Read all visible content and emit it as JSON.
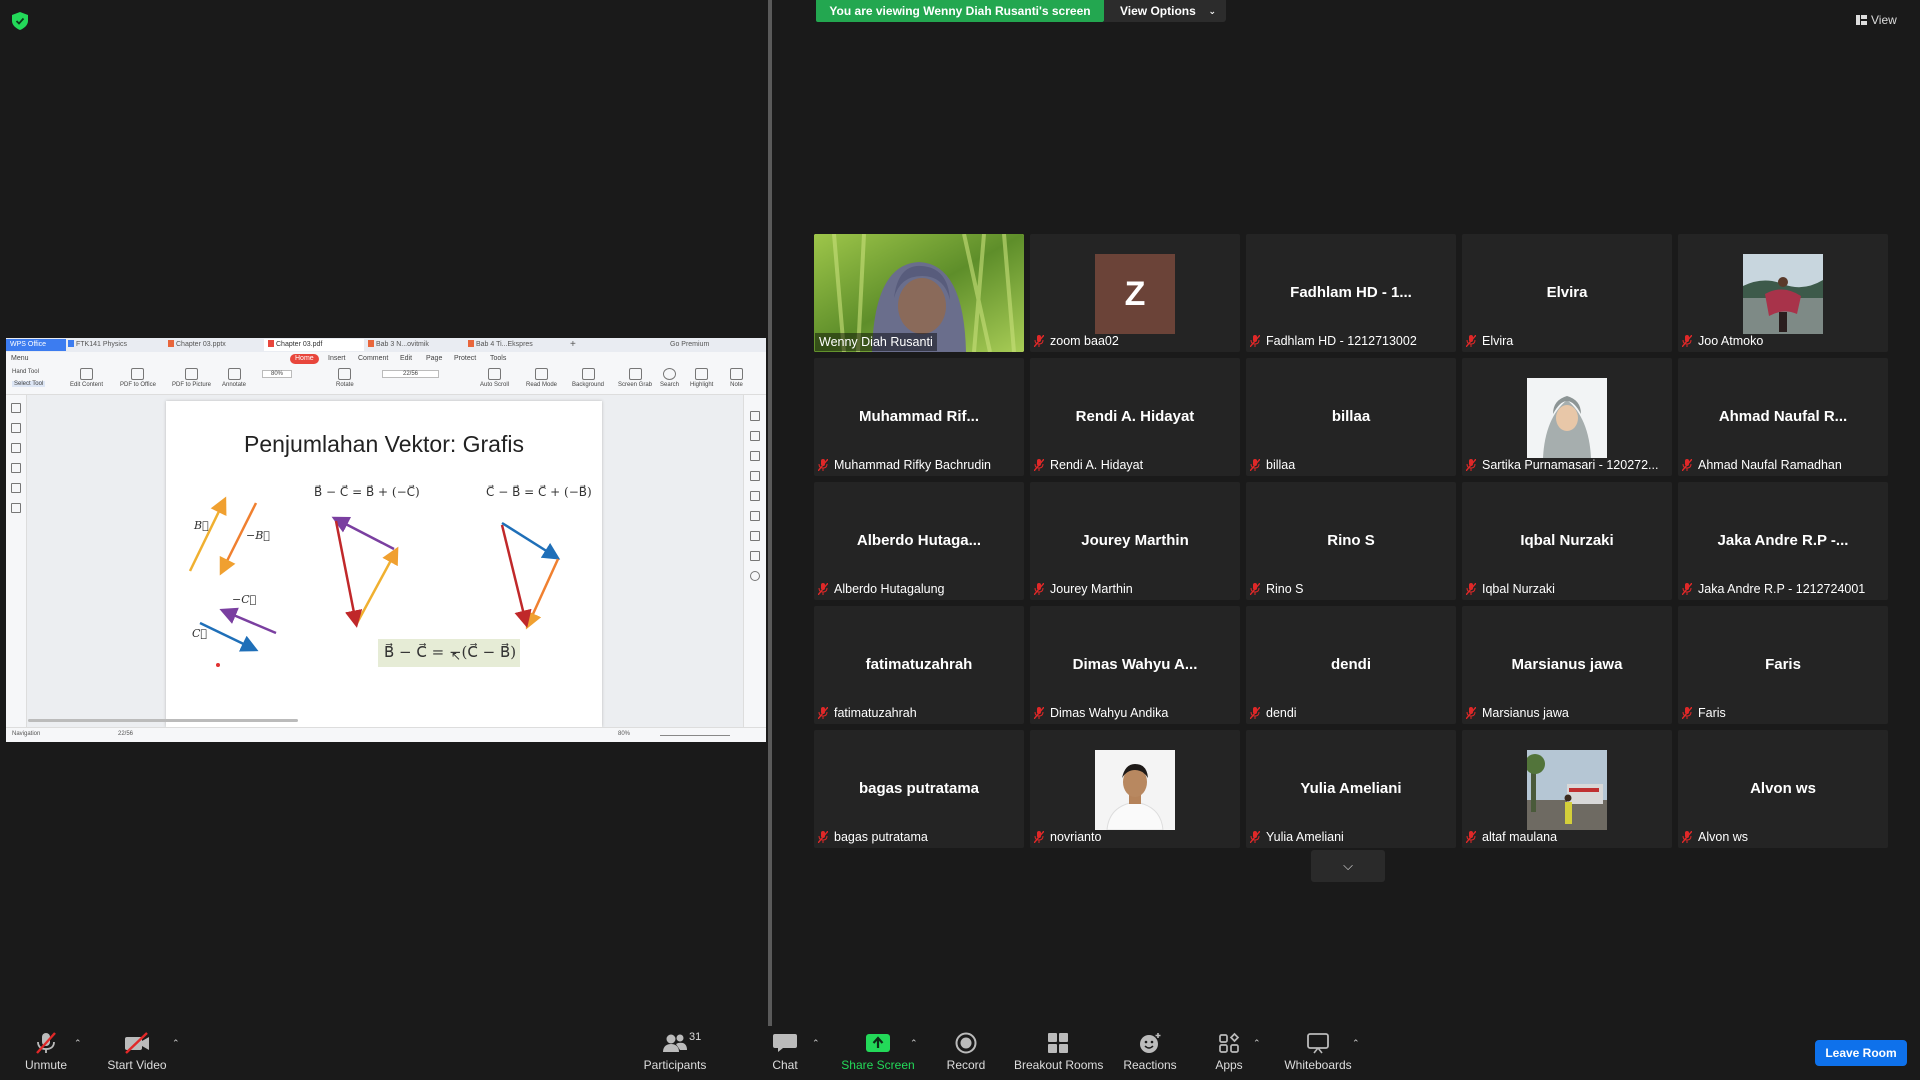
{
  "banner": {
    "viewing_text": "You are viewing Wenny Diah Rusanti's screen",
    "view_options_label": "View Options",
    "view_label": "View"
  },
  "shared_window": {
    "tabs": [
      "WPS Office",
      "FTK141 Physics",
      "Chapter 03.pptx",
      "Chapter 03.pdf",
      "Bab 3 N...ovitmik",
      "Bab 4 Ti...Ekspres"
    ],
    "go_premium": "Go Premium",
    "menu_label": "Menu",
    "menu_items": [
      "Home",
      "Insert",
      "Comment",
      "Edit",
      "Page",
      "Protect",
      "Tools"
    ],
    "hand_tool": "Hand Tool",
    "select_tool": "Select Tool",
    "toolbar_items": [
      "Edit Content",
      "PDF to Office",
      "PDF to Picture",
      "Annotate",
      "Rotate",
      "Auto Scroll",
      "Read Mode",
      "Background",
      "Screen Grab",
      "Search",
      "Highlight",
      "Note"
    ],
    "zoom": "80%",
    "page_indicator": "22/56",
    "slide_title": "Penjumlahan Vektor: Grafis",
    "eq1": "B⃗ − C⃗ = B⃗ + (−C⃗)",
    "eq2": "C⃗ − B⃗ = C⃗ + (−B⃗)",
    "eq_main": "B⃗ − C⃗ = −(C⃗ − B⃗)",
    "label_b": "B⃗",
    "label_neg_b": "−B⃗",
    "label_neg_c": "−C⃗",
    "label_c": "C⃗",
    "status_nav": "Navigation",
    "status_page": "22/56",
    "status_zoom": "80%"
  },
  "participants": [
    {
      "big": "",
      "name": "Wenny Diah Rusanti",
      "type": "video",
      "active": true,
      "muted": false
    },
    {
      "big": "",
      "name": "zoom baa02",
      "type": "letter",
      "letter": "Z",
      "muted": true
    },
    {
      "big": "Fadhlam HD - 1...",
      "name": "Fadhlam HD - 1212713002",
      "type": "name",
      "muted": true
    },
    {
      "big": "Elvira",
      "name": "Elvira",
      "type": "name",
      "muted": true
    },
    {
      "big": "",
      "name": "Joo Atmoko",
      "type": "photo",
      "photo": "beach",
      "muted": true
    },
    {
      "big": "Muhammad  Rif...",
      "name": "Muhammad Rifky Bachrudin",
      "type": "name",
      "muted": true
    },
    {
      "big": "Rendi A. Hidayat",
      "name": "Rendi A. Hidayat",
      "type": "name",
      "muted": true
    },
    {
      "big": "billaa",
      "name": "billaa",
      "type": "name",
      "muted": true
    },
    {
      "big": "",
      "name": "Sartika Purnamasari - 120272...",
      "type": "photo",
      "photo": "hijab",
      "muted": true
    },
    {
      "big": "Ahmad Naufal R...",
      "name": "Ahmad Naufal Ramadhan",
      "type": "name",
      "muted": true
    },
    {
      "big": "Alberdo  Hutaga...",
      "name": "Alberdo Hutagalung",
      "type": "name",
      "muted": true
    },
    {
      "big": "Jourey Marthin",
      "name": "Jourey Marthin",
      "type": "name",
      "muted": true
    },
    {
      "big": "Rino S",
      "name": "Rino S",
      "type": "name",
      "muted": true
    },
    {
      "big": "Iqbal Nurzaki",
      "name": "Iqbal Nurzaki",
      "type": "name",
      "muted": true
    },
    {
      "big": "Jaka Andre R.P -...",
      "name": "Jaka Andre R.P - 1212724001",
      "type": "name",
      "muted": true
    },
    {
      "big": "fatimatuzahrah",
      "name": "fatimatuzahrah",
      "type": "name",
      "muted": true
    },
    {
      "big": "Dimas Wahyu A...",
      "name": "Dimas Wahyu Andika",
      "type": "name",
      "muted": true
    },
    {
      "big": "dendi",
      "name": "dendi",
      "type": "name",
      "muted": true
    },
    {
      "big": "Marsianus jawa",
      "name": "Marsianus jawa",
      "type": "name",
      "muted": true
    },
    {
      "big": "Faris",
      "name": "Faris",
      "type": "name",
      "muted": true
    },
    {
      "big": "bagas putratama",
      "name": "bagas putratama",
      "type": "name",
      "muted": true
    },
    {
      "big": "",
      "name": "novrianto",
      "type": "photo",
      "photo": "man",
      "muted": true
    },
    {
      "big": "Yulia Ameliani",
      "name": "Yulia Ameliani",
      "type": "name",
      "muted": true
    },
    {
      "big": "",
      "name": "altaf maulana",
      "type": "photo",
      "photo": "street",
      "muted": true
    },
    {
      "big": "Alvon ws",
      "name": "Alvon ws",
      "type": "name",
      "muted": true
    }
  ],
  "toolbar": {
    "unmute": "Unmute",
    "start_video": "Start Video",
    "participants": "Participants",
    "participants_count": "31",
    "chat": "Chat",
    "share_screen": "Share Screen",
    "record": "Record",
    "breakout_rooms": "Breakout Rooms",
    "reactions": "Reactions",
    "apps": "Apps",
    "whiteboards": "Whiteboards",
    "leave_room": "Leave Room"
  },
  "colors": {
    "banner_green": "#23a750",
    "active_speaker": "#f0e66a",
    "leave_blue": "#0e71eb",
    "muted_red": "#e02828",
    "share_green": "#23d959"
  }
}
